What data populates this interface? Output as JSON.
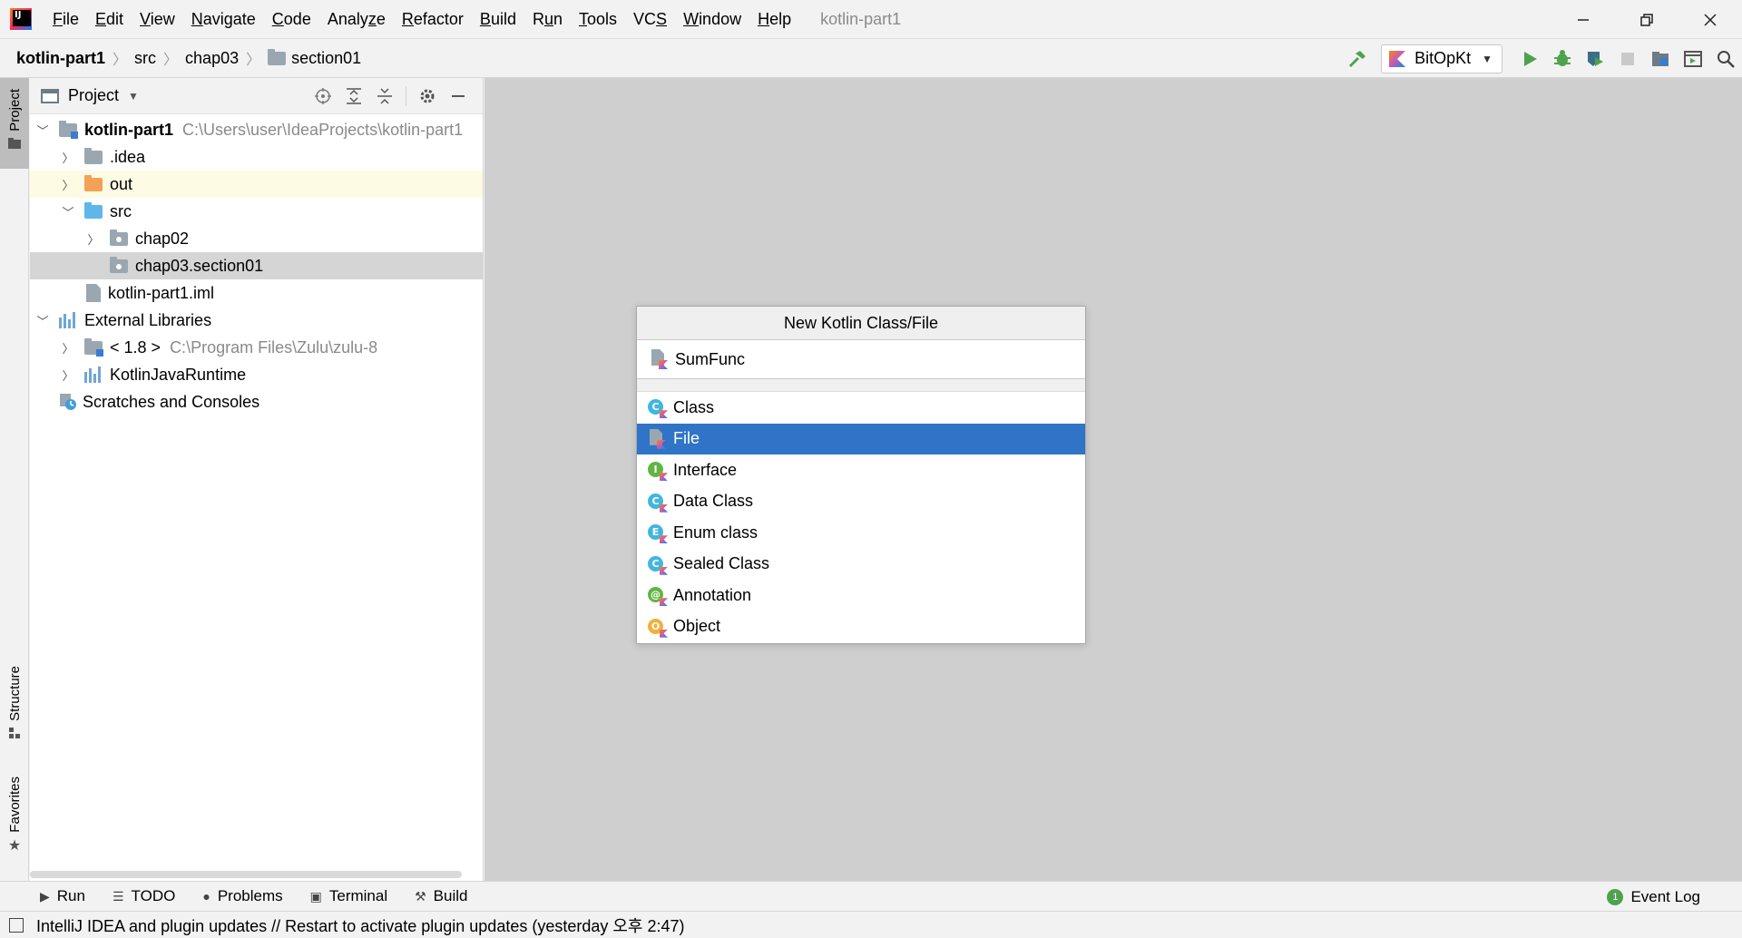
{
  "window": {
    "title": "kotlin-part1",
    "menu": [
      {
        "pre": "",
        "u": "F",
        "post": "ile"
      },
      {
        "pre": "",
        "u": "E",
        "post": "dit"
      },
      {
        "pre": "",
        "u": "V",
        "post": "iew"
      },
      {
        "pre": "",
        "u": "N",
        "post": "avigate"
      },
      {
        "pre": "",
        "u": "C",
        "post": "ode"
      },
      {
        "pre": "Analy",
        "u": "z",
        "post": "e"
      },
      {
        "pre": "",
        "u": "R",
        "post": "efactor"
      },
      {
        "pre": "",
        "u": "B",
        "post": "uild"
      },
      {
        "pre": "R",
        "u": "u",
        "post": "n"
      },
      {
        "pre": "",
        "u": "T",
        "post": "ools"
      },
      {
        "pre": "VC",
        "u": "S",
        "post": ""
      },
      {
        "pre": "",
        "u": "W",
        "post": "indow"
      },
      {
        "pre": "",
        "u": "H",
        "post": "elp"
      }
    ]
  },
  "breadcrumb": {
    "root": "kotlin-part1",
    "items": [
      "src",
      "chap03",
      "section01"
    ]
  },
  "run_config": {
    "name": "BitOpKt"
  },
  "colors": {
    "accent_green": "#4fa24d",
    "selection_blue": "#2f74c6",
    "editor_bg": "#cfcfcf"
  },
  "left_stripe": {
    "project": "Project",
    "structure": "Structure",
    "favorites": "Favorites"
  },
  "project_panel": {
    "title": "Project",
    "tree": [
      {
        "label": "kotlin-part1",
        "path": "C:\\Users\\user\\IdeaProjects\\kotlin-part1",
        "bold": true
      },
      {
        "label": ".idea"
      },
      {
        "label": "out"
      },
      {
        "label": "src"
      },
      {
        "label": "chap02"
      },
      {
        "label": "chap03.section01"
      },
      {
        "label": "kotlin-part1.iml"
      },
      {
        "label": "External Libraries"
      },
      {
        "label": "< 1.8 >",
        "path": "C:\\Program Files\\Zulu\\zulu-8"
      },
      {
        "label": "KotlinJavaRuntime"
      },
      {
        "label": "Scratches and Consoles"
      }
    ]
  },
  "popup": {
    "title": "New Kotlin Class/File",
    "input_value": "SumFunc",
    "items": [
      {
        "label": "Class",
        "icon": "class-icon",
        "letter": "C",
        "color": "#40b6e0"
      },
      {
        "label": "File",
        "icon": "kotlin-file-icon",
        "selected": true
      },
      {
        "label": "Interface",
        "icon": "interface-icon",
        "letter": "I",
        "color": "#62b543"
      },
      {
        "label": "Data Class",
        "icon": "data-class-icon",
        "letter": "C",
        "color": "#40b6e0"
      },
      {
        "label": "Enum class",
        "icon": "enum-icon",
        "letter": "E",
        "color": "#40b6e0"
      },
      {
        "label": "Sealed Class",
        "icon": "sealed-class-icon",
        "letter": "C",
        "color": "#40b6e0"
      },
      {
        "label": "Annotation",
        "icon": "annotation-icon",
        "letter": "@",
        "color": "#62b543"
      },
      {
        "label": "Object",
        "icon": "object-icon",
        "letter": "O",
        "color": "#f4af3d"
      }
    ]
  },
  "bottom_tabs": [
    {
      "label": "Run",
      "icon": "run-icon"
    },
    {
      "label": "TODO",
      "icon": "todo-icon"
    },
    {
      "label": "Problems",
      "icon": "problems-icon"
    },
    {
      "label": "Terminal",
      "icon": "terminal-icon"
    },
    {
      "label": "Build",
      "icon": "build-icon"
    }
  ],
  "event_log": {
    "label": "Event Log",
    "count": "1"
  },
  "status": {
    "message": "IntelliJ IDEA and plugin updates // Restart to activate plugin updates (yesterday 오후 2:47)"
  }
}
